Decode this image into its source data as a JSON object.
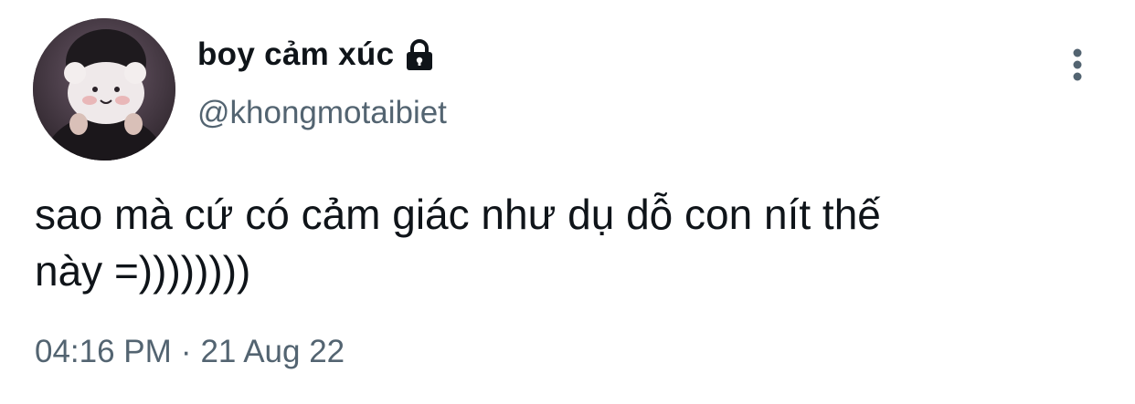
{
  "tweet": {
    "display_name": "boy cảm xúc",
    "protected_icon": "lock-icon",
    "handle": "@khongmotaibiet",
    "text": "sao mà cứ có cảm giác như dụ dỗ con nít thế\nnày =))))))))",
    "time": "04:16 PM",
    "separator": "·",
    "date": "21 Aug 22",
    "more_icon": "vertical-ellipsis-icon"
  },
  "colors": {
    "text_primary": "#0f1419",
    "text_secondary": "#536471",
    "background": "#ffffff"
  }
}
